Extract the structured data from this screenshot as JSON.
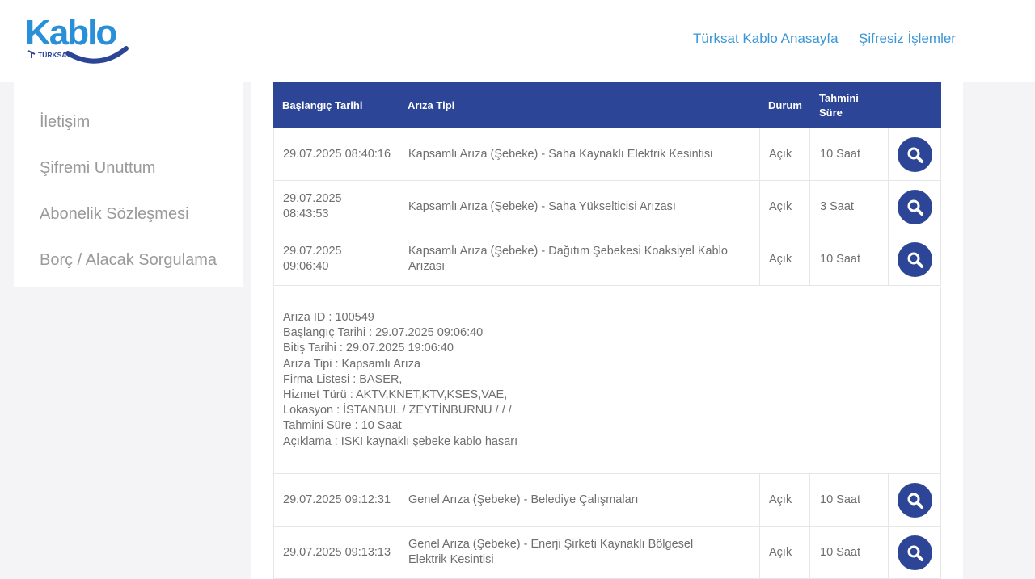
{
  "header": {
    "logo_text": "Kablo",
    "logo_subtext": "TÜRKSAT",
    "nav": [
      {
        "label": "Türksat Kablo Anasayfa"
      },
      {
        "label": "Şifresiz İşlemler"
      }
    ]
  },
  "sidebar": {
    "items": [
      {
        "label": "İletişim"
      },
      {
        "label": "Şifremi Unuttum"
      },
      {
        "label": "Abonelik Sözleşmesi"
      },
      {
        "label": "Borç / Alacak Sorgulama"
      }
    ]
  },
  "table": {
    "headers": {
      "start_date": "Başlangıç Tarihi",
      "type": "Arıza Tipi",
      "status": "Durum",
      "duration_line1": "Tahmini",
      "duration_line2": "Süre"
    },
    "rows": [
      {
        "date": "29.07.2025 08:40:16",
        "type": "Kapsamlı Arıza (Şebeke) - Saha Kaynaklı Elektrik Kesintisi",
        "status": "Açık",
        "duration": "10 Saat"
      },
      {
        "date": "29.07.2025 08:43:53",
        "type": "Kapsamlı Arıza (Şebeke) - Saha Yükselticisi Arızası",
        "status": "Açık",
        "duration": "3 Saat"
      },
      {
        "date": "29.07.2025 09:06:40",
        "type": "Kapsamlı Arıza (Şebeke) - Dağıtım Şebekesi Koaksiyel Kablo Arızası",
        "status": "Açık",
        "duration": "10 Saat"
      },
      {
        "date": "29.07.2025 09:12:31",
        "type": "Genel Arıza (Şebeke) - Belediye Çalışmaları",
        "status": "Açık",
        "duration": "10 Saat"
      },
      {
        "date": "29.07.2025 09:13:13",
        "type": "Genel Arıza (Şebeke) - Enerji Şirketi Kaynaklı Bölgesel Elektrik Kesintisi",
        "status": "Açık",
        "duration": "10 Saat"
      }
    ],
    "detail": [
      "Arıza ID : 100549",
      "Başlangıç Tarihi : 29.07.2025 09:06:40",
      "Bitiş Tarihi : 29.07.2025 19:06:40",
      "Arıza Tipi : Kapsamlı Arıza",
      "Firma Listesi : BASER,",
      "Hizmet Türü : AKTV,KNET,KTV,KSES,VAE,",
      "Lokasyon : İSTANBUL / ZEYTİNBURNU / / /",
      "Tahmini Süre : 10 Saat",
      "Açıklama : ISKI kaynaklı şebeke kablo hasarı"
    ]
  },
  "colors": {
    "brand_blue": "#3a96d6",
    "header_navy": "#2c4596"
  }
}
